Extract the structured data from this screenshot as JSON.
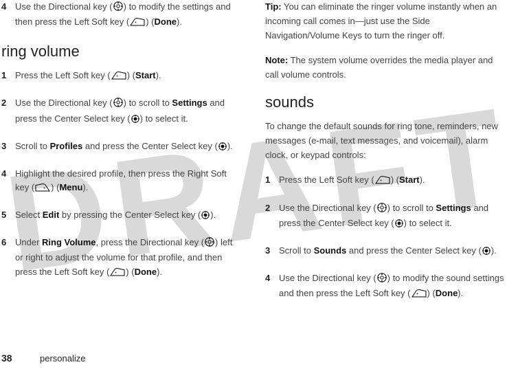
{
  "left": {
    "step4top": {
      "num": "4",
      "pre": "Use the Directional key (",
      "mid1": ") to modify the settings and then press the Left Soft key (",
      "mid2": ") (",
      "done": "Done",
      "post": ")."
    },
    "heading_ring": "ring volume",
    "s1": {
      "num": "1",
      "pre": "Press the Left Soft key (",
      "mid": ") (",
      "start": "Start",
      "post": ")."
    },
    "s2": {
      "num": "2",
      "pre": "Use the Directional key (",
      "mid1": ") to scroll to ",
      "settings": "Settings",
      "mid2": " and press the Center Select key (",
      "post": ") to select it."
    },
    "s3": {
      "num": "3",
      "pre": "Scroll to ",
      "profiles": "Profiles",
      "mid": " and press the Center Select key (",
      "post": ")."
    },
    "s4": {
      "num": "4",
      "pre": "Highlight the desired profile, then press the Right Soft key (",
      "mid": ") (",
      "menu": "Menu",
      "post": ")."
    },
    "s5": {
      "num": "5",
      "pre": "Select ",
      "edit": "Edit",
      "mid": " by pressing the Center Select key (",
      "post": ")."
    },
    "s6": {
      "num": "6",
      "pre": "Under ",
      "rv": "Ring Volume",
      "mid1": ", press the Directional key (",
      "mid2": ") left or right to adjust the volume for that profile, and then press the Left Soft key (",
      "mid3": ") (",
      "done": "Done",
      "post": ")."
    }
  },
  "right": {
    "tip": {
      "label": "Tip:",
      "text": " You can eliminate the ringer volume instantly when an incoming call comes in—just use the Side Navigation/Volume Keys to turn the ringer off."
    },
    "note": {
      "label": "Note:",
      "text": " The system volume overrides the media player and call volume controls."
    },
    "heading_sounds": "sounds",
    "intro": "To change the default sounds for ring tone, reminders, new messages (e-mail, text messages, and voicemail), alarm clock, or keypad controls:",
    "s1": {
      "num": "1",
      "pre": "Press the Left Soft key (",
      "mid": ") (",
      "start": "Start",
      "post": ")."
    },
    "s2": {
      "num": "2",
      "pre": "Use the Directional key (",
      "mid1": ") to scroll to ",
      "settings": "Settings",
      "mid2": " and press the Center Select key (",
      "post": ") to select it."
    },
    "s3": {
      "num": "3",
      "pre": "Scroll to ",
      "sounds": "Sounds",
      "mid": " and press the Center Select key (",
      "post": ")."
    },
    "s4": {
      "num": "4",
      "pre": "Use the Directional key (",
      "mid1": ") to modify the sound settings and then press the Left Soft key (",
      "mid2": ") (",
      "done": "Done",
      "post": ")."
    }
  },
  "footer": {
    "page": "38",
    "section": "personalize"
  }
}
